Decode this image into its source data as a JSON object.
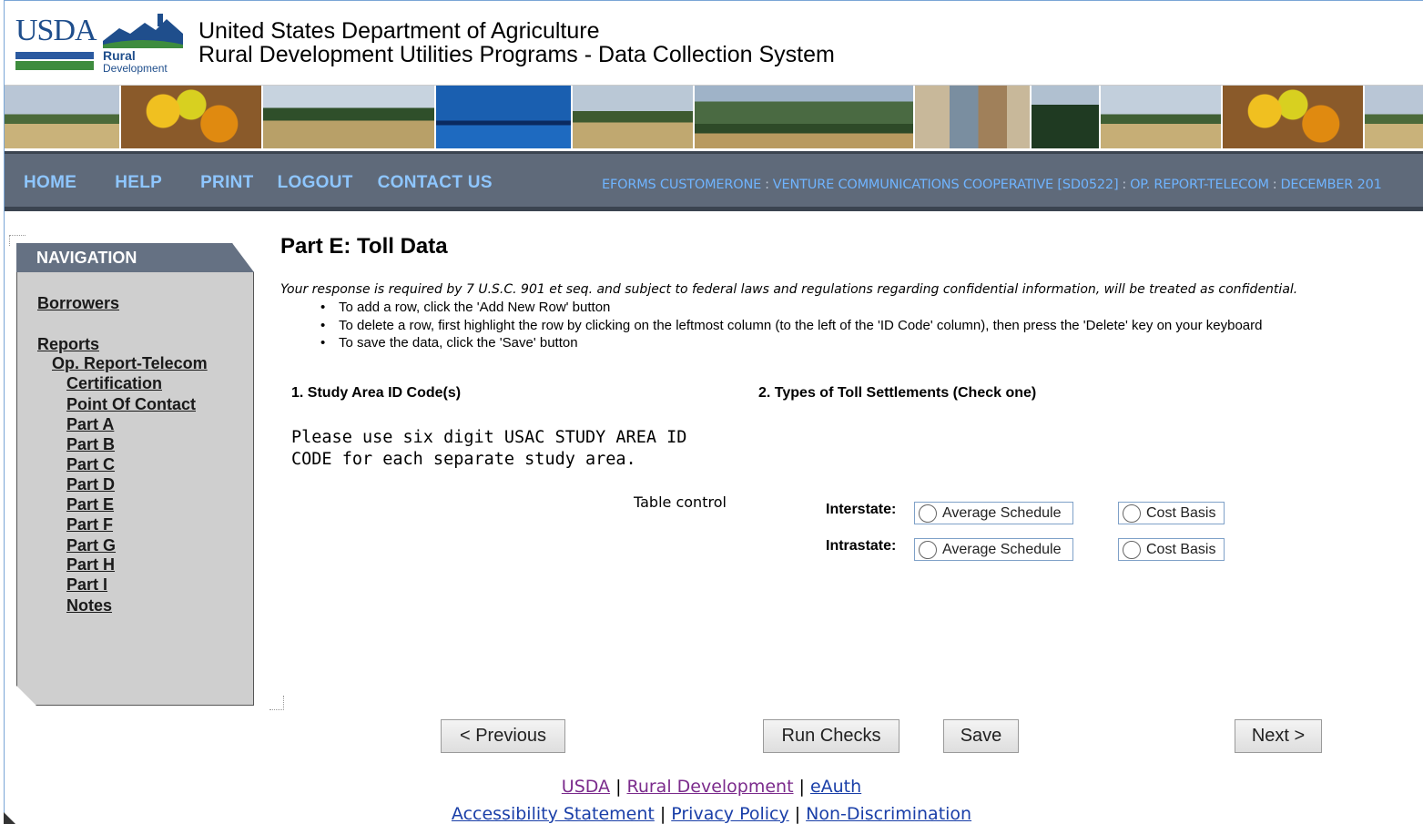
{
  "header": {
    "logo_usda": "USDA",
    "logo_rural": "Rural",
    "logo_development": "Development",
    "title_line1": "United States Department of Agriculture",
    "title_line2": "Rural Development Utilities Programs - Data Collection System"
  },
  "topnav": {
    "items": [
      "HOME",
      "HELP",
      "PRINT",
      "LOGOUT",
      "CONTACT US"
    ],
    "context": [
      "EFORMS CUSTOMERONE",
      "VENTURE COMMUNICATIONS COOPERATIVE [SD0522]",
      "OP. REPORT-TELECOM",
      "DECEMBER 201"
    ],
    "context_separator": ":"
  },
  "sidenav": {
    "title": "NAVIGATION",
    "borrowers": "Borrowers",
    "reports": "Reports",
    "report_name": "Op. Report-Telecom",
    "items": [
      "Certification",
      "Point Of Contact",
      "Part A",
      "Part B",
      "Part C",
      "Part D",
      "Part E",
      "Part F",
      "Part G",
      "Part H",
      "Part I",
      "Notes"
    ]
  },
  "main": {
    "title": "Part E: Toll Data",
    "notice": "Your response is required by 7 U.S.C. 901 et seq. and subject to federal laws and regulations regarding confidential information, will be treated as confidential.",
    "instructions": [
      "To add a row, click the 'Add New Row' button",
      "To delete a row, first highlight the row by clicking on the leftmost column (to the left of the 'ID Code' column), then press the 'Delete' key on your keyboard",
      "To save the data, click the 'Save' button"
    ],
    "section1_label": "1. Study Area ID Code(s)",
    "section2_label": "2. Types of Toll Settlements (Check one)",
    "study_note": "Please use six digit USAC STUDY AREA ID CODE for each separate study area.",
    "table_control": "Table control",
    "interstate_label": "Interstate:",
    "intrastate_label": "Intrastate:",
    "option_average": "Average Schedule",
    "option_cost": "Cost Basis"
  },
  "buttons": {
    "previous": "< Previous",
    "run_checks": "Run Checks",
    "save": "Save",
    "next": "Next >"
  },
  "footer": {
    "row1": [
      "USDA",
      "Rural Development",
      "eAuth"
    ],
    "row2": [
      "Accessibility Statement",
      "Privacy Policy",
      "Non-Discrimination"
    ],
    "separator": "|"
  },
  "colors": {
    "nav_bar": "#5f6a7a",
    "nav_link": "#8ec6ff",
    "sidenav_bg": "#cfcfcf",
    "sidenav_head": "#657183",
    "link_visited": "#7b2b8c",
    "link": "#1a3fa8"
  }
}
